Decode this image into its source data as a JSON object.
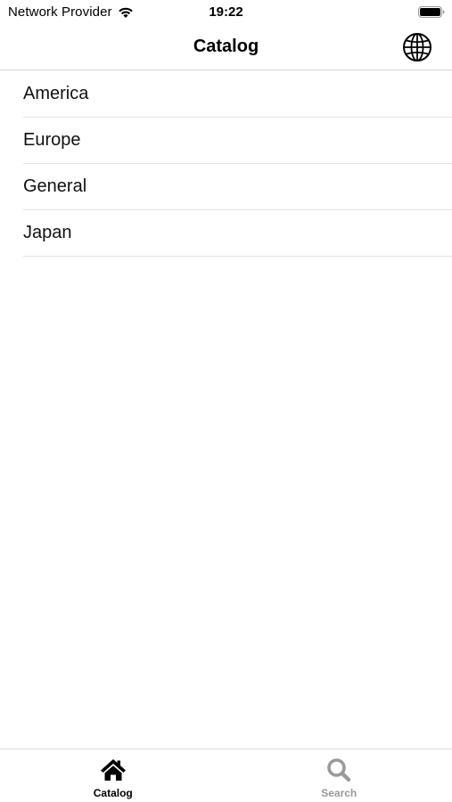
{
  "status_bar": {
    "carrier": "Network Provider",
    "time": "19:22",
    "wifi_icon": "wifi-icon",
    "battery_icon": "battery-full-icon"
  },
  "nav_bar": {
    "title": "Catalog",
    "right_icon": "globe-icon"
  },
  "catalog": {
    "items": [
      {
        "label": "America"
      },
      {
        "label": "Europe"
      },
      {
        "label": "General"
      },
      {
        "label": "Japan"
      }
    ]
  },
  "tab_bar": {
    "tabs": [
      {
        "label": "Catalog",
        "icon": "home-icon",
        "active": true
      },
      {
        "label": "Search",
        "icon": "search-icon",
        "active": false
      }
    ]
  },
  "colors": {
    "active_tab": "#000000",
    "inactive_tab": "#9a9a9a",
    "separator": "#e3e3e3",
    "background": "#ffffff"
  }
}
